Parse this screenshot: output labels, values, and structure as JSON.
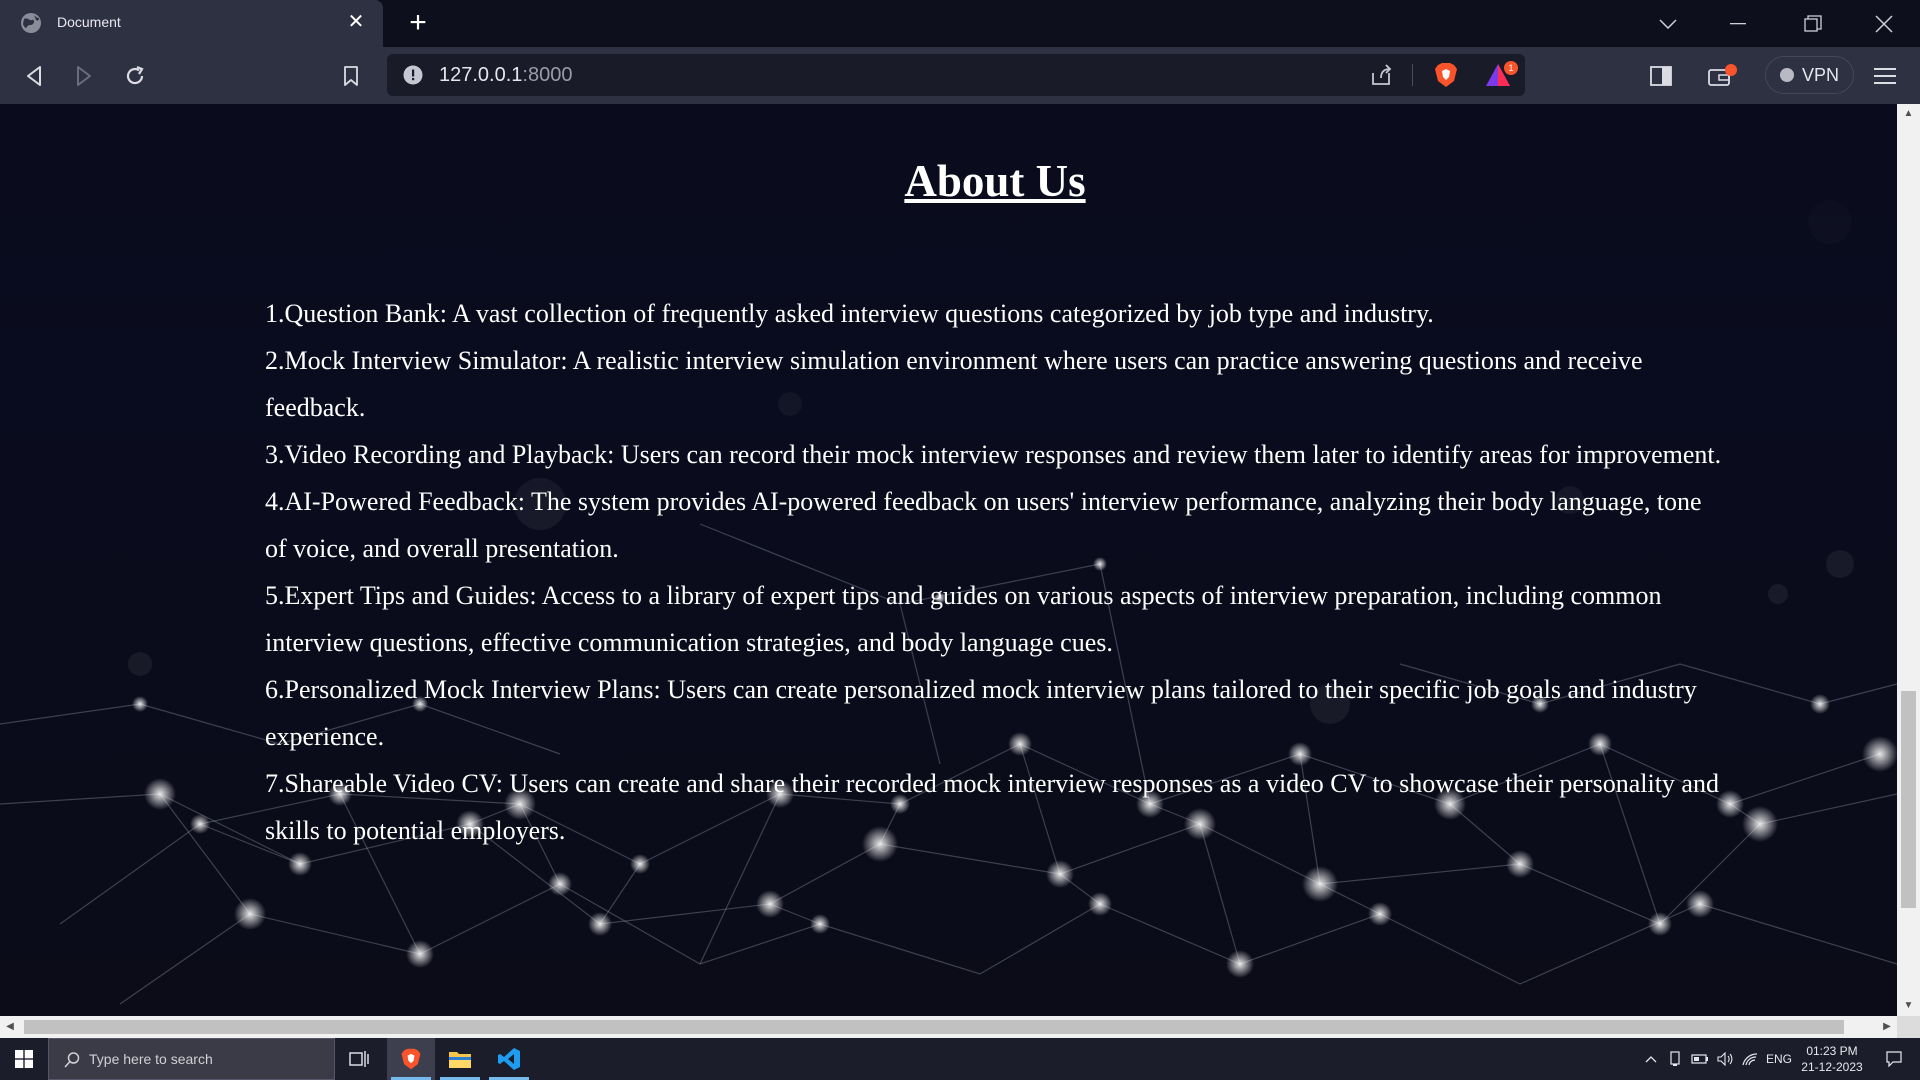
{
  "browser": {
    "tab_title": "Document",
    "url_host": "127.0.0.1",
    "url_port": ":8000",
    "vpn_label": "VPN",
    "rewards_badge": "1"
  },
  "page": {
    "title": "About Us",
    "features": [
      "1.Question Bank: A vast collection of frequently asked interview questions categorized by job type and industry.",
      "2.Mock Interview Simulator: A realistic interview simulation environment where users can practice answering questions and receive feedback.",
      "3.Video Recording and Playback: Users can record their mock interview responses and review them later to identify areas for improvement.",
      "4.AI-Powered Feedback: The system provides AI-powered feedback on users' interview performance, analyzing their body language, tone of voice, and overall presentation.",
      "5.Expert Tips and Guides: Access to a library of expert tips and guides on various aspects of interview preparation, including common interview questions, effective communication strategies, and body language cues.",
      "6.Personalized Mock Interview Plans: Users can create personalized mock interview plans tailored to their specific job goals and industry experience.",
      "7.Shareable Video CV: Users can create and share their recorded mock interview responses as a video CV to showcase their personality and skills to potential employers."
    ]
  },
  "taskbar": {
    "search_placeholder": "Type here to search",
    "language": "ENG",
    "time": "01:23 PM",
    "date": "21-12-2023"
  },
  "colors": {
    "page_bg": "#0b0d1c",
    "browser_chrome": "#2e3142",
    "brave_orange": "#fb542b",
    "vscode_blue": "#1f9cf0"
  }
}
